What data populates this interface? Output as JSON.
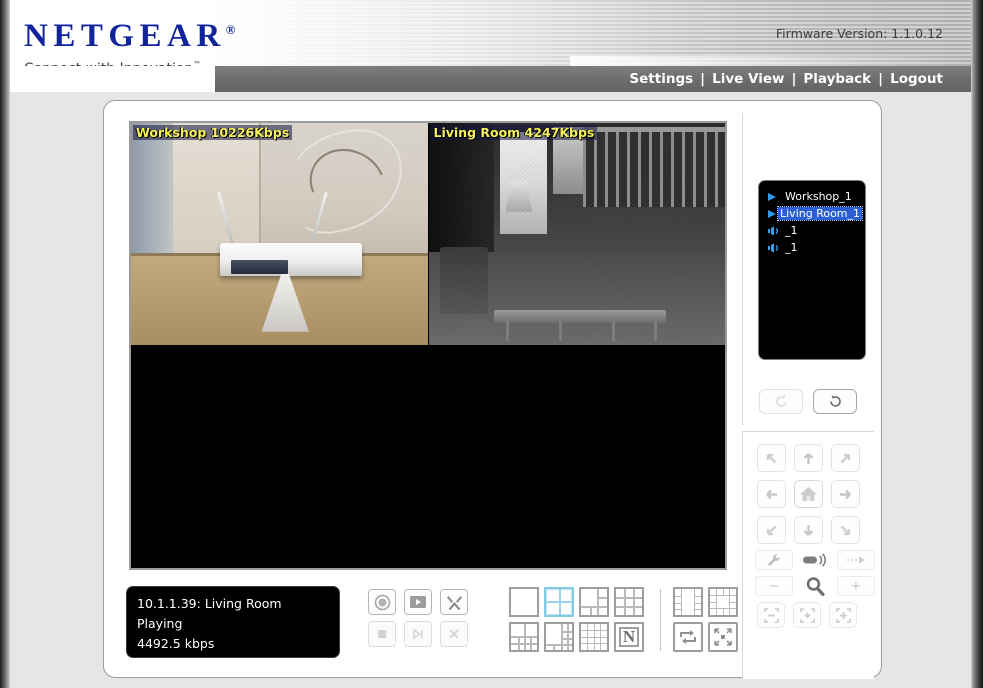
{
  "header": {
    "brand": "NETGEAR",
    "brand_registered": "®",
    "tagline": "Connect with Innovation",
    "tagline_tm": "™",
    "firmware": "Firmware Version: 1.1.0.12",
    "brand_color": "#12249b"
  },
  "nav": {
    "separator": "|",
    "items": [
      {
        "label": "Settings"
      },
      {
        "label": "Live View"
      },
      {
        "label": "Playback"
      },
      {
        "label": "Logout"
      }
    ]
  },
  "video": {
    "panes": [
      {
        "label": "Workshop 10226Kbps",
        "camera": "Workshop",
        "bitrate": "10226Kbps",
        "active": true
      },
      {
        "label": "Living Room 4247Kbps",
        "camera": "Living Room",
        "bitrate": "4247Kbps",
        "active": true
      },
      {
        "label": "",
        "camera": "",
        "bitrate": "",
        "active": false
      },
      {
        "label": "",
        "camera": "",
        "bitrate": "",
        "active": false
      }
    ],
    "label_color": "#f7f35a"
  },
  "status": {
    "line1": "10.1.1.39: Living Room",
    "line2": "Playing",
    "line3": "4492.5 kbps"
  },
  "playback_controls": {
    "row1": [
      {
        "name": "record-button",
        "icon": "record-icon",
        "disabled": false
      },
      {
        "name": "snapshot-button",
        "icon": "play-frame-icon",
        "disabled": false
      },
      {
        "name": "tools-button",
        "icon": "wrench-hammer-icon",
        "disabled": false
      }
    ],
    "row2": [
      {
        "name": "stop-button",
        "icon": "stop-icon",
        "disabled": true
      },
      {
        "name": "step-forward-button",
        "icon": "step-forward-icon",
        "disabled": true
      },
      {
        "name": "close-stream-button",
        "icon": "close-x-icon",
        "disabled": true
      }
    ]
  },
  "layouts": {
    "options": [
      {
        "name": "layout-1x1",
        "cells": "1",
        "selected": false
      },
      {
        "name": "layout-2x2",
        "cells": "4",
        "selected": true
      },
      {
        "name": "layout-1plus5",
        "cells": "6",
        "selected": false
      },
      {
        "name": "layout-3x3",
        "cells": "9",
        "selected": false
      },
      {
        "name": "layout-2plus8",
        "cells": "10",
        "selected": false
      },
      {
        "name": "layout-1plus12",
        "cells": "13",
        "selected": false
      },
      {
        "name": "layout-4x4",
        "cells": "16",
        "selected": false
      },
      {
        "name": "layout-netgear-logo",
        "cells": "N",
        "selected": false,
        "glyph": "N"
      }
    ],
    "extra": [
      {
        "name": "layout-1plus7-wide",
        "selected": false
      },
      {
        "name": "layout-1plus12-border",
        "selected": false
      },
      {
        "name": "sequence-rotate-button",
        "icon": "rotate-arrows-icon"
      },
      {
        "name": "fullscreen-button",
        "icon": "expand-arrows-icon"
      }
    ]
  },
  "camera_tree": {
    "items": [
      {
        "label": "Workshop_1",
        "icon": "camera-play-icon",
        "selected": false
      },
      {
        "label": "Living Room_1",
        "icon": "camera-play-icon",
        "selected": true
      },
      {
        "label": "_1",
        "icon": "audio-speaker-icon",
        "selected": false
      },
      {
        "label": "_1",
        "icon": "audio-speaker-icon",
        "selected": false
      }
    ],
    "selection_color": "#2a5fd6"
  },
  "refresh_buttons": [
    {
      "name": "rotate-clockwise-button",
      "icon": "rotate-cw-icon",
      "disabled": true
    },
    {
      "name": "rotate-counterclockwise-button",
      "icon": "rotate-ccw-icon",
      "disabled": false
    }
  ],
  "ptz": {
    "pad": [
      {
        "name": "ptz-up-left-button",
        "icon": "arrow-up-left-icon"
      },
      {
        "name": "ptz-up-button",
        "icon": "arrow-up-icon"
      },
      {
        "name": "ptz-up-right-button",
        "icon": "arrow-up-right-icon"
      },
      {
        "name": "ptz-left-button",
        "icon": "arrow-left-icon"
      },
      {
        "name": "ptz-home-button",
        "icon": "home-icon"
      },
      {
        "name": "ptz-right-button",
        "icon": "arrow-right-icon"
      },
      {
        "name": "ptz-down-left-button",
        "icon": "arrow-down-left-icon"
      },
      {
        "name": "ptz-down-button",
        "icon": "arrow-down-icon"
      },
      {
        "name": "ptz-down-right-button",
        "icon": "arrow-down-right-icon"
      }
    ],
    "focus_zoom": [
      {
        "name": "focus-near-button",
        "icon": "wrench-icon",
        "label": ""
      },
      {
        "name": "focus-indicator",
        "icon": "focus-lens-icon",
        "label": ""
      },
      {
        "name": "focus-far-button",
        "icon": "focus-far-icon",
        "label": ""
      },
      {
        "name": "zoom-out-button",
        "icon": "minus-icon",
        "label": "−"
      },
      {
        "name": "zoom-indicator",
        "icon": "magnifier-icon",
        "label": ""
      },
      {
        "name": "zoom-in-button",
        "icon": "plus-icon",
        "label": "+"
      }
    ],
    "presets": [
      {
        "name": "preset-remove-button",
        "icon": "frame-minus-icon"
      },
      {
        "name": "preset-center-button",
        "icon": "frame-center-icon"
      },
      {
        "name": "preset-add-button",
        "icon": "frame-plus-icon"
      }
    ]
  }
}
